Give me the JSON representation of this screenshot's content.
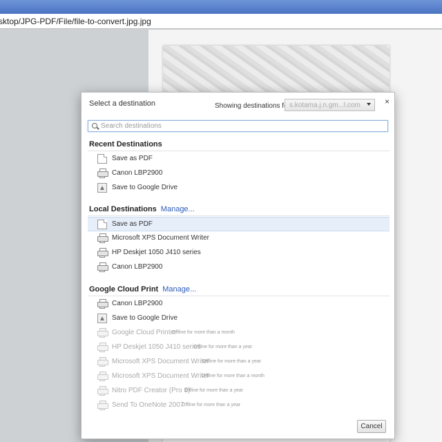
{
  "browser": {
    "address": "sktop/JPG-PDF/File/file-to-convert.jpg.jpg"
  },
  "dialog": {
    "title": "Select a destination",
    "showing_label": "Showing destinations for",
    "account": "s.kotama.j.n.gm...l.com",
    "search_placeholder": "Search destinations",
    "cancel_label": "Cancel",
    "close_glyph": "×"
  },
  "recent": {
    "heading": "Recent Destinations",
    "items": [
      {
        "label": "Save as PDF",
        "icon": "pdf-document-icon"
      },
      {
        "label": "Canon LBP2900",
        "icon": "printer-icon"
      },
      {
        "label": "Save to Google Drive",
        "icon": "google-drive-icon"
      }
    ]
  },
  "local": {
    "heading": "Local Destinations",
    "manage": "Manage...",
    "items": [
      {
        "label": "Save as PDF",
        "icon": "pdf-document-icon",
        "selected": true
      },
      {
        "label": "Microsoft XPS Document Writer",
        "icon": "printer-icon"
      },
      {
        "label": "HP Deskjet 1050 J410 series",
        "icon": "printer-icon"
      },
      {
        "label": "Canon LBP2900",
        "icon": "printer-icon"
      }
    ]
  },
  "cloud": {
    "heading": "Google Cloud Print",
    "manage": "Manage...",
    "items": [
      {
        "label": "Canon LBP2900",
        "icon": "printer-icon",
        "status": ""
      },
      {
        "label": "Save to Google Drive",
        "icon": "google-drive-icon",
        "status": ""
      },
      {
        "label": "Google Cloud Printer",
        "icon": "printer-icon",
        "status": "Offline for more than a month"
      },
      {
        "label": "HP Deskjet 1050 J410 series",
        "icon": "printer-icon",
        "status": "Offline for more than a year"
      },
      {
        "label": "Microsoft XPS Document Writer",
        "icon": "printer-icon",
        "status": "Offline for more than a year"
      },
      {
        "label": "Microsoft XPS Document Writer",
        "icon": "printer-icon",
        "status": "Offline for more than a month"
      },
      {
        "label": "Nitro PDF Creator (Pro 8)",
        "icon": "printer-icon",
        "status": "Offline for more than a year"
      },
      {
        "label": "Send To OneNote 2007",
        "icon": "printer-icon",
        "status": "Offline for more than a year"
      }
    ]
  },
  "colors": {
    "titlebar": "#4a74c2",
    "link": "#2a5bb8",
    "selected_row": "#e6eefa",
    "search_focus": "#8fb4e0"
  }
}
